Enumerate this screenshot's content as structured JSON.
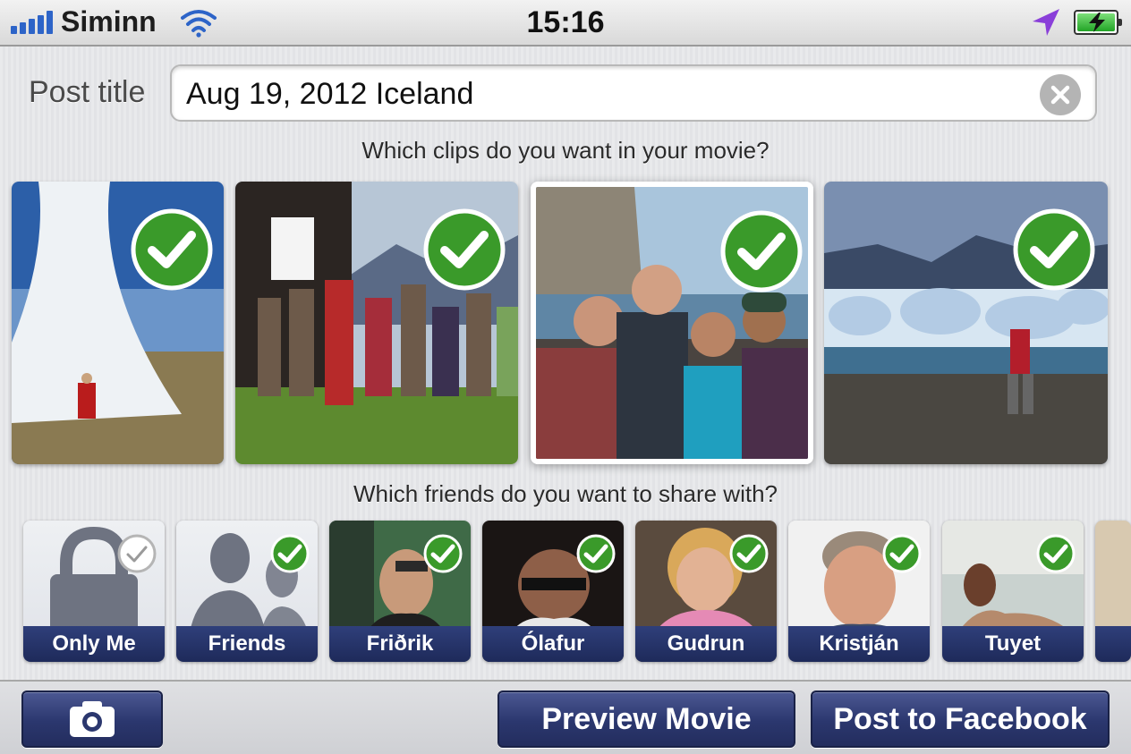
{
  "status_bar": {
    "carrier": "Siminn",
    "time": "15:16",
    "signal_icon": "signal-bars-icon",
    "wifi_icon": "wifi-icon",
    "location_icon": "location-arrow-icon",
    "battery_icon": "battery-charging-icon",
    "battery_level": 1.0
  },
  "post": {
    "label": "Post title",
    "value": "Aug 19, 2012 Iceland",
    "clear_icon": "clear-x-icon"
  },
  "clips": {
    "prompt": "Which clips do you want in your movie?",
    "items": [
      {
        "id": "geyser",
        "selected": true
      },
      {
        "id": "group-house",
        "selected": true
      },
      {
        "id": "friends-beach",
        "selected": true,
        "highlighted": true
      },
      {
        "id": "glacier-lagoon",
        "selected": true
      }
    ]
  },
  "friends": {
    "prompt": "Which friends do you want to share with?",
    "items": [
      {
        "name": "Only Me",
        "selected": false,
        "icon": "lock-icon"
      },
      {
        "name": "Friends",
        "selected": true,
        "icon": "friends-silhouette-icon"
      },
      {
        "name": "Friðrik",
        "selected": true
      },
      {
        "name": "Ólafur",
        "selected": true
      },
      {
        "name": "Gudrun",
        "selected": true
      },
      {
        "name": "Kristján",
        "selected": true
      },
      {
        "name": "Tuyet",
        "selected": true
      }
    ]
  },
  "toolbar": {
    "camera_icon": "camera-icon",
    "preview_label": "Preview Movie",
    "post_label": "Post to Facebook"
  },
  "colors": {
    "accent_navy": "#2b376e",
    "check_green": "#3a9a2a",
    "signal_blue": "#2d64c8",
    "location_purple": "#8a3fd9"
  }
}
